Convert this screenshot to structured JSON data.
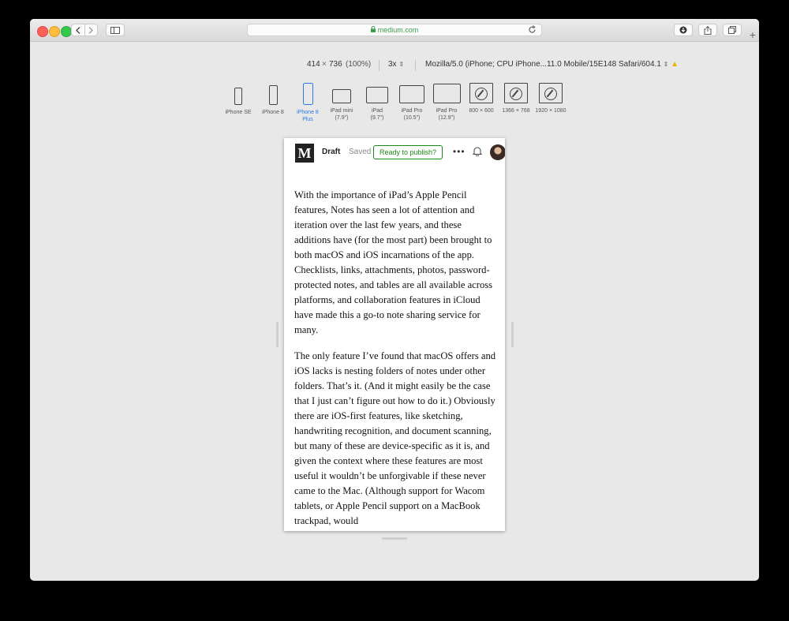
{
  "browser": {
    "url": "medium.com"
  },
  "responsive_toolbar": {
    "viewport_width": "414",
    "times": "×",
    "viewport_height": "736",
    "zoom": "(100%)",
    "pixel_ratio": "3x",
    "user_agent": "Mozilla/5.0 (iPhone; CPU iPhone...11.0 Mobile/15E148 Safari/604.1"
  },
  "devices": [
    {
      "label_line1": "iPhone SE",
      "label_line2": ""
    },
    {
      "label_line1": "iPhone 8",
      "label_line2": ""
    },
    {
      "label_line1": "iPhone 8",
      "label_line2": "Plus"
    },
    {
      "label_line1": "iPad mini",
      "label_line2": "(7.9\")"
    },
    {
      "label_line1": "iPad",
      "label_line2": "(9.7\")"
    },
    {
      "label_line1": "iPad Pro",
      "label_line2": "(10.5\")"
    },
    {
      "label_line1": "iPad Pro",
      "label_line2": "(12.9\")"
    },
    {
      "label_line1": "800 × 600",
      "label_line2": ""
    },
    {
      "label_line1": "1366 × 768",
      "label_line2": ""
    },
    {
      "label_line1": "1920 × 1080",
      "label_line2": ""
    }
  ],
  "medium": {
    "logo": "M",
    "status": "Draft",
    "saved": "Saved",
    "publish_label": "Ready to publish?",
    "more": "•••",
    "paragraphs": [
      "With the importance of iPad’s Apple Pencil features, Notes has seen a lot of attention and iteration over the last few years, and these additions have (for the most part) been brought to both macOS and iOS incarnations of the app. Checklists, links, attachments, photos, password-protected notes, and tables are all available across platforms, and collaboration features in iCloud have made this a go-to note sharing service for many.",
      "The only feature I’ve found that macOS offers and iOS lacks is nesting folders of notes under other folders. That’s it. (And it might easily be the case that I just can’t figure out how to do it.) Obviously there are iOS-first features, like sketching, handwriting recognition, and document scanning, but many of these are device-specific as it is, and given the context where these features are most useful it wouldn’t be unforgivable if these never came to the Mac. (Although support for Wacom tablets, or Apple Pencil support on a MacBook trackpad, would"
    ]
  }
}
